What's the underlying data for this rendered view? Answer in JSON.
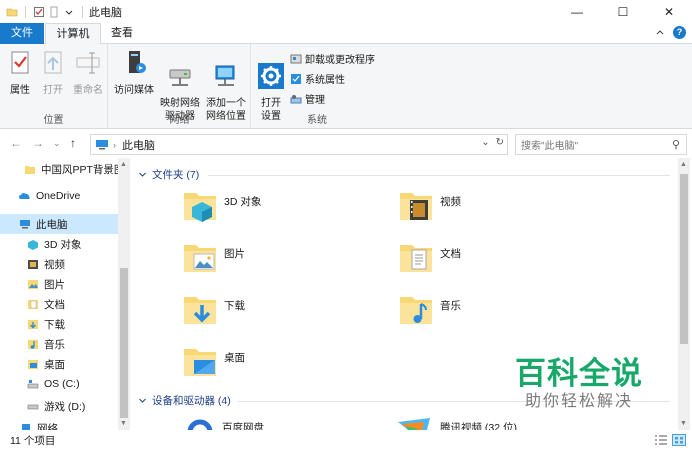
{
  "window": {
    "title": "此电脑",
    "controls": {
      "minimize": "—",
      "maximize": "☐",
      "close": "✕"
    }
  },
  "ribbon_tabs": [
    {
      "label": "文件",
      "active": false
    },
    {
      "label": "计算机",
      "active": true
    },
    {
      "label": "查看",
      "active": false
    }
  ],
  "ribbon": {
    "groups": [
      {
        "label": "位置",
        "buttons": [
          "属性",
          "打开",
          "重命名"
        ]
      },
      {
        "label": "网络",
        "buttons": [
          "访问媒体",
          "映射网络\n驱动器",
          "添加一个\n网络位置"
        ]
      },
      {
        "label": "系统",
        "big_button": "打开\n设置",
        "small_buttons": [
          "卸载或更改程序",
          "系统属性",
          "管理"
        ]
      }
    ]
  },
  "address_bar": {
    "path": "此电脑",
    "search_placeholder": "搜索\"此电脑\""
  },
  "nav_pane": [
    {
      "label": "中国风PPT背景图",
      "icon": "folder-icon",
      "selected": false
    },
    {
      "label": "OneDrive",
      "icon": "onedrive-icon",
      "selected": false
    },
    {
      "label": "此电脑",
      "icon": "computer-icon",
      "selected": true
    },
    {
      "label": "3D 对象",
      "icon": "3d-objects-icon",
      "selected": false
    },
    {
      "label": "视频",
      "icon": "video-icon",
      "selected": false
    },
    {
      "label": "图片",
      "icon": "picture-icon",
      "selected": false
    },
    {
      "label": "文档",
      "icon": "document-icon",
      "selected": false
    },
    {
      "label": "下载",
      "icon": "download-icon",
      "selected": false
    },
    {
      "label": "音乐",
      "icon": "music-icon",
      "selected": false
    },
    {
      "label": "桌面",
      "icon": "desktop-icon",
      "selected": false
    },
    {
      "label": "OS (C:)",
      "icon": "drive-icon",
      "selected": false
    },
    {
      "label": "游戏 (D:)",
      "icon": "drive-icon",
      "selected": false
    },
    {
      "label": "网络",
      "icon": "network-icon",
      "selected": false
    }
  ],
  "sections": {
    "folders": {
      "header": "文件夹 (7)",
      "items": [
        {
          "label": "3D 对象",
          "icon": "3d-objects-folder-icon"
        },
        {
          "label": "视频",
          "icon": "video-folder-icon"
        },
        {
          "label": "图片",
          "icon": "picture-folder-icon"
        },
        {
          "label": "文档",
          "icon": "document-folder-icon"
        },
        {
          "label": "下载",
          "icon": "download-folder-icon"
        },
        {
          "label": "音乐",
          "icon": "music-folder-icon"
        },
        {
          "label": "桌面",
          "icon": "desktop-folder-icon"
        }
      ]
    },
    "devices": {
      "header": "设备和驱动器 (4)",
      "items": [
        {
          "label": "百度网盘",
          "icon": "baidu-netdisk-icon"
        },
        {
          "label": "腾讯视频 (32 位)",
          "icon": "tencent-video-icon"
        }
      ]
    }
  },
  "status": {
    "item_count": "11 个项目"
  },
  "watermark": {
    "line1": "百科全说",
    "line2": "助你轻松解决"
  },
  "colors": {
    "accent": "#1979ca",
    "selected_bg": "#cce8ff",
    "folder_yellow": "#f8d775",
    "section_header": "#1e3f8a",
    "watermark_green": "#17a86a"
  }
}
